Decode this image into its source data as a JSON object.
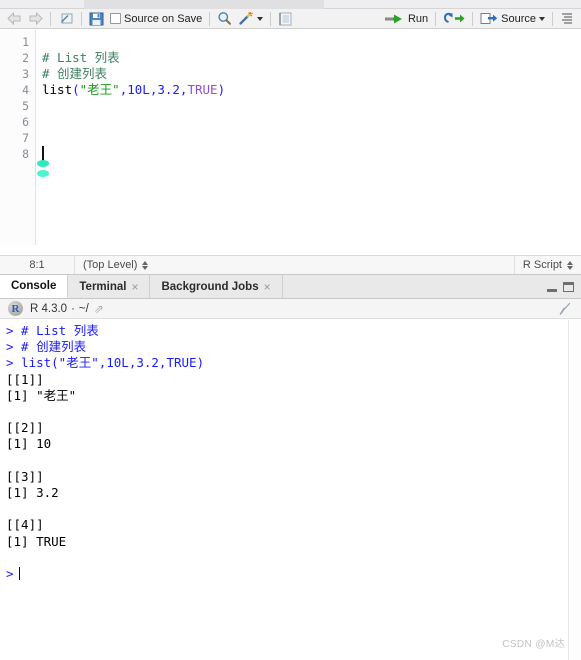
{
  "editor": {
    "toolbar": {
      "back_icon": "back-arrow-icon",
      "forward_icon": "forward-arrow-icon",
      "show_in_new_window_icon": "popout-window-icon",
      "save_icon": "save-floppy-icon",
      "source_on_save_label": "Source on Save",
      "find_icon": "magnifier-icon",
      "code_tools_icon": "magic-wand-icon",
      "compile_report_icon": "notebook-icon",
      "run_label": "Run",
      "run_icon": "run-arrow-icon",
      "rerun_icon": "rerun-loop-icon",
      "source_label": "Source",
      "source_icon": "source-arrow-icon",
      "outline_icon": "document-outline-icon"
    },
    "line_numbers": [
      "1",
      "2",
      "3",
      "4",
      "5",
      "6",
      "7",
      "8"
    ],
    "code": {
      "line2_comment": "# List 列表",
      "line3_comment": "# 创建列表",
      "line4": {
        "fn": "list",
        "open": "(",
        "string": "\"老王\"",
        "comma1": ",",
        "num_int": "10L",
        "comma2": ",",
        "num_dbl": "3.2",
        "comma3": ",",
        "const": "TRUE",
        "close": ")"
      }
    },
    "status": {
      "cursor_position": "8:1",
      "scope": "(Top Level)",
      "file_type": "R Script"
    }
  },
  "console": {
    "tabs": [
      {
        "label": "Console",
        "closable": false,
        "active": true
      },
      {
        "label": "Terminal",
        "closable": true,
        "active": false
      },
      {
        "label": "Background Jobs",
        "closable": true,
        "active": false
      }
    ],
    "window_controls": {
      "minimize_icon": "minimize-icon",
      "maximize_icon": "maximize-icon"
    },
    "header": {
      "r_logo": "r-logo-icon",
      "version": "R 4.3.0",
      "separator": "·",
      "working_dir": "~/",
      "popout_icon": "popout-arrow-icon",
      "clear_icon": "broom-clear-icon"
    },
    "lines": [
      {
        "text": "> # List 列表",
        "type": "input"
      },
      {
        "text": "> # 创建列表",
        "type": "input"
      },
      {
        "text": "> list(\"老王\",10L,3.2,TRUE)",
        "type": "input"
      },
      {
        "text": "[[1]]",
        "type": "output"
      },
      {
        "text": "[1] \"老王\"",
        "type": "output"
      },
      {
        "text": "",
        "type": "blank"
      },
      {
        "text": "[[2]]",
        "type": "output"
      },
      {
        "text": "[1] 10",
        "type": "output"
      },
      {
        "text": "",
        "type": "blank"
      },
      {
        "text": "[[3]]",
        "type": "output"
      },
      {
        "text": "[1] 3.2",
        "type": "output"
      },
      {
        "text": "",
        "type": "blank"
      },
      {
        "text": "[[4]]",
        "type": "output"
      },
      {
        "text": "[1] TRUE",
        "type": "output"
      },
      {
        "text": "",
        "type": "blank"
      },
      {
        "text": ">",
        "type": "prompt"
      }
    ]
  },
  "watermark": {
    "text": "CSDN @M达"
  },
  "colors": {
    "comment": "#3f7f5f",
    "string": "#1a9b1a",
    "number": "#1a1aff",
    "constant": "#8d4fd6",
    "console_input": "#1a1aff",
    "run_green": "#2aa02a",
    "save_blue": "#3b78b8",
    "ime_teal": "#2fe8c0"
  }
}
